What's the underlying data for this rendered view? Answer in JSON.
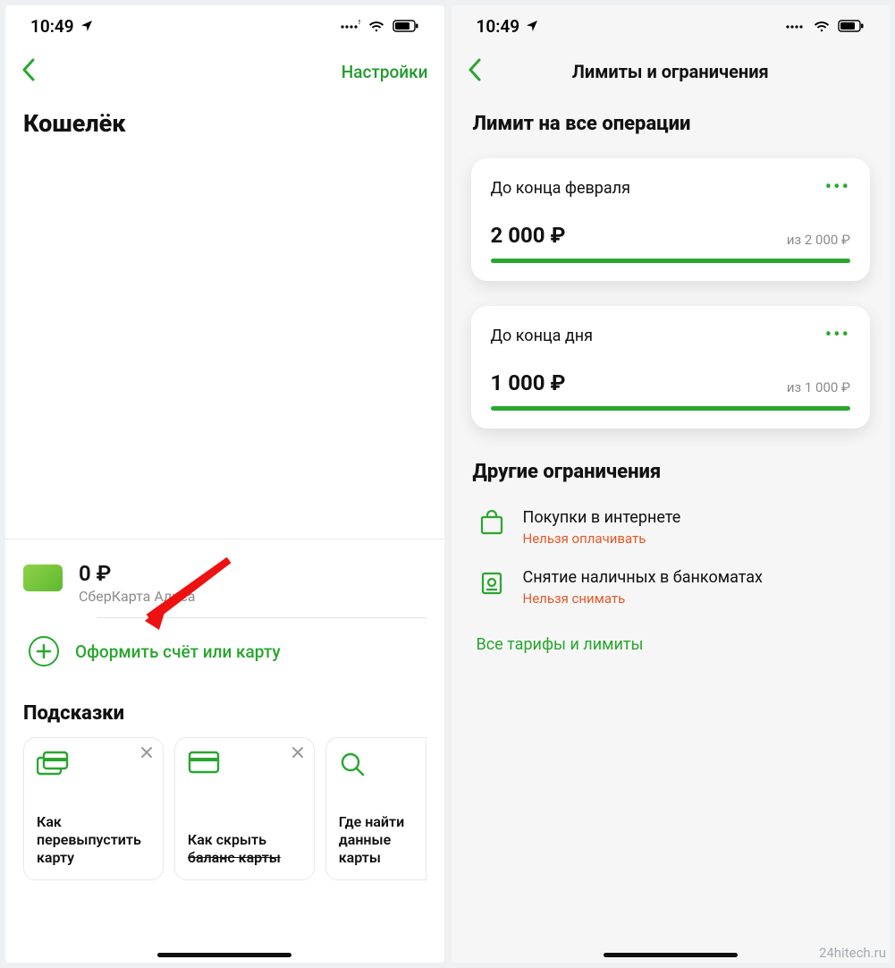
{
  "statusbar": {
    "time": "10:49"
  },
  "left": {
    "nav": {
      "settings_label": "Настройки"
    },
    "wallet_title": "Кошелёк",
    "card": {
      "amount": "0 ₽",
      "name": "СберКарта Алиса"
    },
    "add_label": "Оформить счёт или карту",
    "suggestions_title": "Подсказки",
    "suggestions": [
      {
        "text_l1": "Как",
        "text_l2": "перевыпустить",
        "text_l3": "карту"
      },
      {
        "text_l1": "Как скрыть",
        "text_l2": "баланс карты",
        "text_l3": ""
      },
      {
        "text_l1": "Где найти",
        "text_l2": "данные карты",
        "text_l3": ""
      }
    ]
  },
  "right": {
    "nav_title": "Лимиты и ограничения",
    "section_all_ops": "Лимит на все операции",
    "limits": [
      {
        "period": "До конца февраля",
        "amount": "2 000 ₽",
        "of": "из 2 000 ₽"
      },
      {
        "period": "До конца дня",
        "amount": "1 000 ₽",
        "of": "из 1 000 ₽"
      }
    ],
    "other_title": "Другие ограничения",
    "restrictions": [
      {
        "title": "Покупки в интернете",
        "sub": "Нельзя оплачивать"
      },
      {
        "title": "Снятие наличных в банкоматах",
        "sub": "Нельзя снимать"
      }
    ],
    "all_link": "Все тарифы и лимиты"
  },
  "watermark": "24hitech.ru"
}
